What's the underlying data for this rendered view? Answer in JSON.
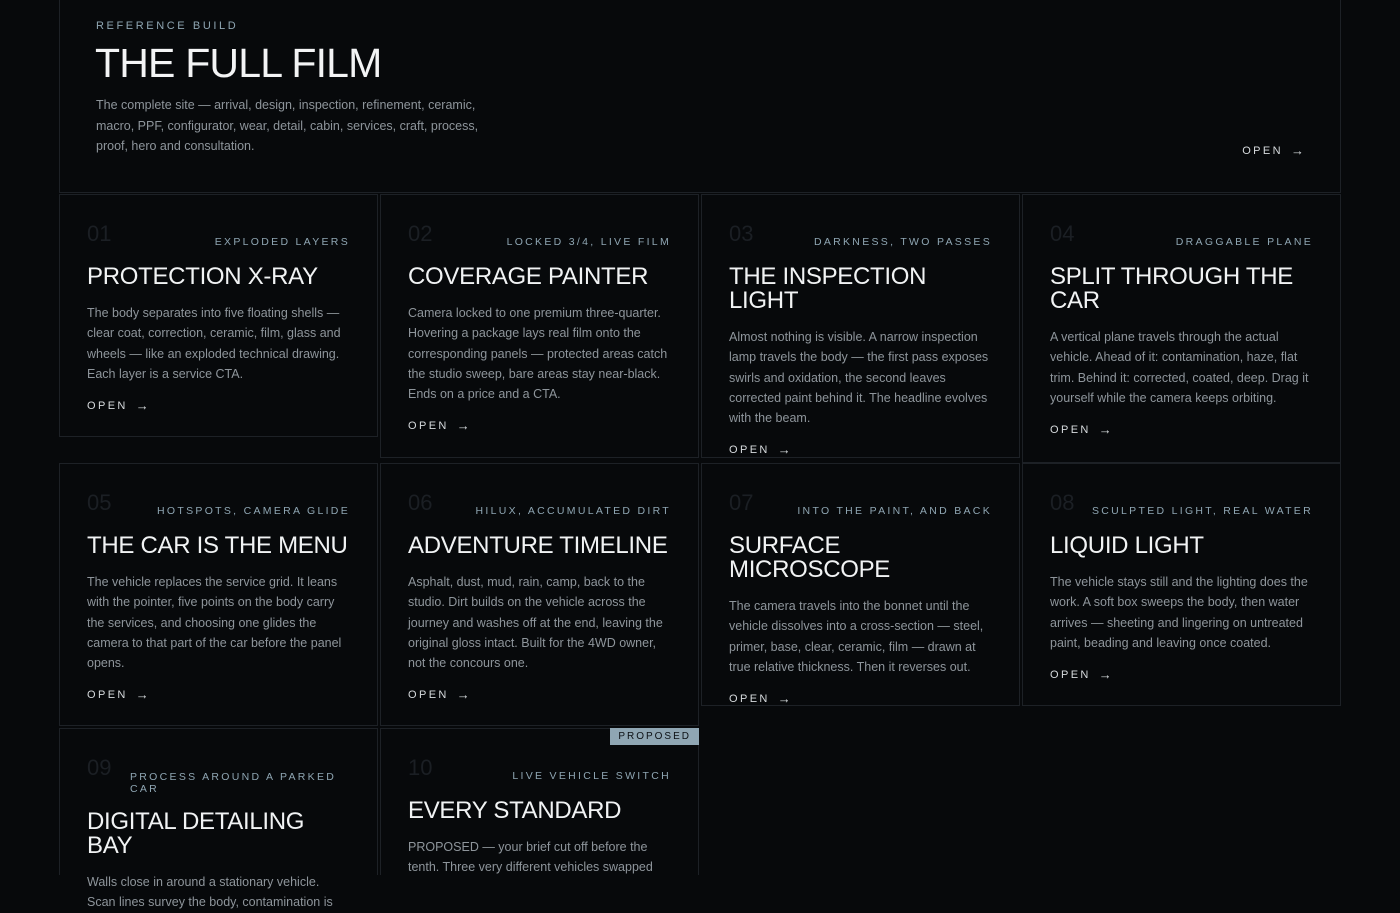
{
  "hero": {
    "eyebrow": "REFERENCE BUILD",
    "title": "THE FULL FILM",
    "description": "The complete site — arrival, design, inspection, refinement, ceramic, macro, PPF, configurator, wear, detail, cabin, services, craft, process, proof, hero and consultation.",
    "open_label": "OPEN",
    "arrow": "→"
  },
  "cards": [
    {
      "num": "01",
      "tag": "EXPLODED LAYERS",
      "title": "PROTECTION X-RAY",
      "description": "The body separates into five floating shells — clear coat, correction, ceramic, film, glass and wheels — like an exploded technical drawing. Each layer is a service CTA.",
      "open_label": "OPEN"
    },
    {
      "num": "02",
      "tag": "LOCKED 3/4, LIVE FILM",
      "title": "COVERAGE PAINTER",
      "description": "Camera locked to one premium three-quarter. Hovering a package lays real film onto the corresponding panels — protected areas catch the studio sweep, bare areas stay near-black. Ends on a price and a CTA.",
      "open_label": "OPEN"
    },
    {
      "num": "03",
      "tag": "DARKNESS, TWO PASSES",
      "title": "THE INSPECTION LIGHT",
      "description": "Almost nothing is visible. A narrow inspection lamp travels the body — the first pass exposes swirls and oxidation, the second leaves corrected paint behind it. The headline evolves with the beam.",
      "open_label": "OPEN"
    },
    {
      "num": "04",
      "tag": "DRAGGABLE PLANE",
      "title": "SPLIT THROUGH THE CAR",
      "description": "A vertical plane travels through the actual vehicle. Ahead of it: contamination, haze, flat trim. Behind it: corrected, coated, deep. Drag it yourself while the camera keeps orbiting.",
      "open_label": "OPEN"
    },
    {
      "num": "05",
      "tag": "HOTSPOTS, CAMERA GLIDE",
      "title": "THE CAR IS THE MENU",
      "description": "The vehicle replaces the service grid. It leans with the pointer, five points on the body carry the services, and choosing one glides the camera to that part of the car before the panel opens.",
      "open_label": "OPEN"
    },
    {
      "num": "06",
      "tag": "HILUX, ACCUMULATED DIRT",
      "title": "ADVENTURE TIMELINE",
      "description": "Asphalt, dust, mud, rain, camp, back to the studio. Dirt builds on the vehicle across the journey and washes off at the end, leaving the original gloss intact. Built for the 4WD owner, not the concours one.",
      "open_label": "OPEN"
    },
    {
      "num": "07",
      "tag": "INTO THE PAINT, AND BACK",
      "title": "SURFACE MICROSCOPE",
      "description": "The camera travels into the bonnet until the vehicle dissolves into a cross-section — steel, primer, base, clear, ceramic, film — drawn at true relative thickness. Then it reverses out.",
      "open_label": "OPEN"
    },
    {
      "num": "08",
      "tag": "SCULPTED LIGHT, REAL WATER",
      "title": "LIQUID LIGHT",
      "description": "The vehicle stays still and the lighting does the work. A soft box sweeps the body, then water arrives — sheeting and lingering on untreated paint, beading and leaving once coated.",
      "open_label": "OPEN"
    },
    {
      "num": "09",
      "tag": "PROCESS AROUND A PARKED CAR",
      "title": "DIGITAL DETAILING BAY",
      "description": "Walls close in around a stationary vehicle. Scan lines survey the body, contamination is",
      "open_label": ""
    },
    {
      "num": "10",
      "tag": "LIVE VEHICLE SWITCH",
      "title": "EVERY STANDARD",
      "description": "PROPOSED — your brief cut off before the tenth. Three very different vehicles swapped",
      "open_label": "",
      "badge": "PROPOSED"
    }
  ]
}
